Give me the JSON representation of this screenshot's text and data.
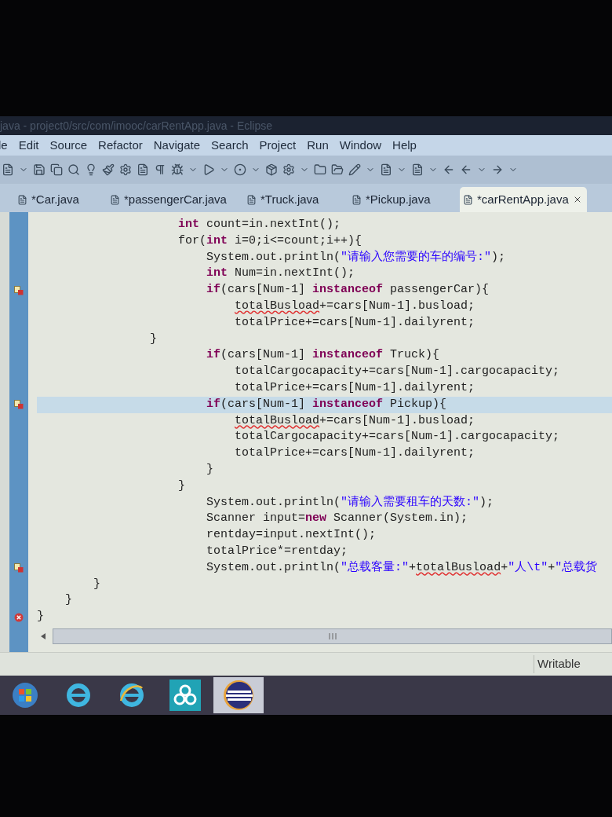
{
  "window": {
    "title": "java - project0/src/com/imooc/carRentApp.java - Eclipse"
  },
  "menu": [
    "le",
    "Edit",
    "Source",
    "Refactor",
    "Navigate",
    "Search",
    "Project",
    "Run",
    "Window",
    "Help"
  ],
  "tabs": [
    {
      "label": "*Car.java",
      "selected": false
    },
    {
      "label": "*passengerCar.java",
      "selected": false
    },
    {
      "label": "*Truck.java",
      "selected": false
    },
    {
      "label": "*Pickup.java",
      "selected": false
    },
    {
      "label": "*carRentApp.java",
      "selected": true
    }
  ],
  "editor": {
    "lines": [
      {
        "tokens": [
          {
            "kind": "kw",
            "text": "                    int"
          },
          {
            "kind": "plain",
            "text": " count=in.nextInt();"
          }
        ]
      },
      {
        "tokens": [
          {
            "kind": "plain",
            "text": "                    for("
          },
          {
            "kind": "kw",
            "text": "int"
          },
          {
            "kind": "plain",
            "text": " i=0;i<=count;i++){"
          }
        ]
      },
      {
        "tokens": [
          {
            "kind": "plain",
            "text": "                        System.out.println("
          },
          {
            "kind": "str",
            "text": "\"请输入您需要的车的编号:\""
          },
          {
            "kind": "plain",
            "text": ");"
          }
        ]
      },
      {
        "tokens": [
          {
            "kind": "kw",
            "text": "                        int"
          },
          {
            "kind": "plain",
            "text": " Num=in.nextInt();"
          }
        ]
      },
      {
        "quick_fix": true,
        "tokens": [
          {
            "kind": "kw",
            "text": "                        if"
          },
          {
            "kind": "plain",
            "text": "(cars[Num-1] "
          },
          {
            "kind": "kw",
            "text": "instanceof"
          },
          {
            "kind": "plain",
            "text": " passengerCar){"
          }
        ]
      },
      {
        "tokens": [
          {
            "kind": "err",
            "text": "                            totalBusload"
          },
          {
            "kind": "plain",
            "text": "+=cars[Num-1].busload;"
          }
        ]
      },
      {
        "tokens": [
          {
            "kind": "plain",
            "text": "                            totalPrice+=cars[Num-1].dailyrent;"
          }
        ]
      },
      {
        "tokens": [
          {
            "kind": "plain",
            "text": "                }"
          }
        ]
      },
      {
        "tokens": [
          {
            "kind": "kw",
            "text": "                        if"
          },
          {
            "kind": "plain",
            "text": "(cars[Num-1] "
          },
          {
            "kind": "kw",
            "text": "instanceof"
          },
          {
            "kind": "plain",
            "text": " Truck){"
          }
        ]
      },
      {
        "tokens": [
          {
            "kind": "plain",
            "text": "                            totalCargocapacity+=cars[Num-1].cargocapacity;"
          }
        ]
      },
      {
        "tokens": [
          {
            "kind": "plain",
            "text": "                            totalPrice+=cars[Num-1].dailyrent;"
          }
        ]
      },
      {
        "current": true,
        "quick_fix": true,
        "tokens": [
          {
            "kind": "kw",
            "text": "                        if"
          },
          {
            "kind": "plain",
            "text": "(cars[Num-1] "
          },
          {
            "kind": "kw",
            "text": "instanceof"
          },
          {
            "kind": "plain",
            "text": " Pickup){"
          }
        ]
      },
      {
        "tokens": [
          {
            "kind": "err",
            "text": "                            totalBusload"
          },
          {
            "kind": "plain",
            "text": "+=cars[Num-1].busload;"
          }
        ]
      },
      {
        "tokens": [
          {
            "kind": "plain",
            "text": "                            totalCargocapacity+=cars[Num-1].cargocapacity;"
          }
        ]
      },
      {
        "tokens": [
          {
            "kind": "plain",
            "text": "                            totalPrice+=cars[Num-1].dailyrent;"
          }
        ]
      },
      {
        "tokens": [
          {
            "kind": "plain",
            "text": "                        }"
          }
        ]
      },
      {
        "tokens": [
          {
            "kind": "plain",
            "text": "                    }"
          }
        ]
      },
      {
        "tokens": [
          {
            "kind": "plain",
            "text": "                        System.out.println("
          },
          {
            "kind": "str",
            "text": "\"请输入需要租车的天数:\""
          },
          {
            "kind": "plain",
            "text": ");"
          }
        ]
      },
      {
        "tokens": [
          {
            "kind": "plain",
            "text": "                        Scanner input="
          },
          {
            "kind": "kw",
            "text": "new"
          },
          {
            "kind": "plain",
            "text": " Scanner(System.in);"
          }
        ]
      },
      {
        "tokens": [
          {
            "kind": "plain",
            "text": "                        rentday=input.nextInt();"
          }
        ]
      },
      {
        "tokens": [
          {
            "kind": "plain",
            "text": "                        totalPrice*=rentday;"
          }
        ]
      },
      {
        "quick_fix": true,
        "tokens": [
          {
            "kind": "plain",
            "text": "                        System.out.println("
          },
          {
            "kind": "str",
            "text": "\"总载客量:\""
          },
          {
            "kind": "plain",
            "text": "+"
          },
          {
            "kind": "err",
            "text": "totalBusload"
          },
          {
            "kind": "plain",
            "text": "+"
          },
          {
            "kind": "str",
            "text": "\"人\\t\""
          },
          {
            "kind": "plain",
            "text": "+"
          },
          {
            "kind": "str",
            "text": "\"总载货"
          }
        ]
      },
      {
        "tokens": [
          {
            "kind": "plain",
            "text": "        }"
          }
        ]
      },
      {
        "tokens": [
          {
            "kind": "plain",
            "text": "    }"
          }
        ]
      },
      {
        "error": true,
        "tokens": [
          {
            "kind": "plain",
            "text": "}"
          }
        ]
      }
    ]
  },
  "status_bar": {
    "mode": "Writable"
  },
  "taskbar": [
    {
      "kind": "start",
      "selected": false
    },
    {
      "kind": "browser",
      "selected": false
    },
    {
      "kind": "browser2",
      "selected": false
    },
    {
      "kind": "cloud",
      "selected": false
    },
    {
      "kind": "ide",
      "selected": true
    }
  ]
}
